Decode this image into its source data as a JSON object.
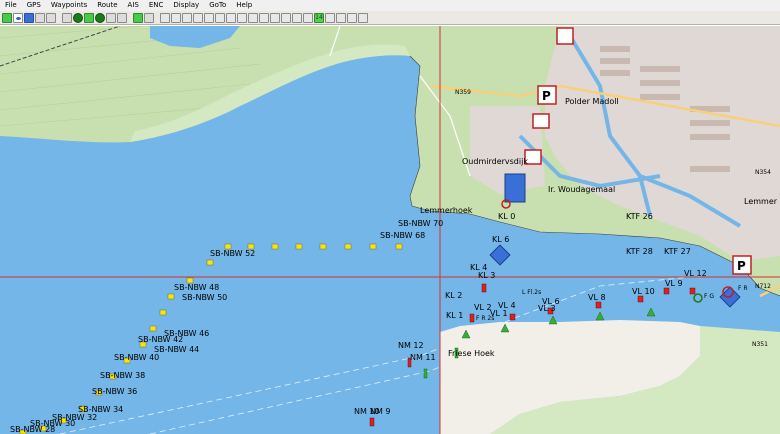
{
  "menu": [
    "File",
    "GPS",
    "Waypoints",
    "Route",
    "AIS",
    "ENC",
    "Display",
    "GoTo",
    "Help"
  ],
  "toolbar": {
    "zoom_levels": [
      "",
      "",
      "",
      "",
      "",
      "",
      "",
      "",
      "",
      "",
      "",
      "",
      "",
      "",
      "14",
      "",
      "",
      "",
      ""
    ],
    "active_zoom": "14"
  },
  "place_labels": {
    "polder": "Polder Madoll",
    "oudmirdum": "Oudmirdervsdijk",
    "woudagemaal": "Ir. Woudagemaal",
    "lemmer": "Lemmer",
    "friese_hoek": "Friese Hoek",
    "road_n359": "N359",
    "road_n712": "N712",
    "road_n354": "N354",
    "road_n351": "N351"
  },
  "chart_labels": [
    "SB-NBW 70",
    "SB-NBW 68",
    "SB-NBW 52",
    "SB-NBW 50",
    "SB-NBW 48",
    "SB-NBW 46",
    "SB-NBW 44",
    "SB-NBW 42",
    "SB-NBW 40",
    "SB-NBW 38",
    "SB-NBW 36",
    "SB-NBW 34",
    "SB-NBW 32",
    "SB-NBW 30",
    "SB-NBW 28",
    "KTF 26",
    "KTF 28",
    "KTF 27",
    "KL 4",
    "KL 3",
    "KL 2",
    "KL 1",
    "VL 2",
    "VL 1",
    "VL 4",
    "VL 3",
    "VL 6",
    "VL 8",
    "VL 10",
    "VL 9",
    "VL 12",
    "KL 6",
    "NM 12",
    "NM 11",
    "NM 10",
    "NM 9",
    "KL 0",
    "Lemmerhoek",
    "F G",
    "F R",
    "F R 2s",
    "L Fl.2s"
  ],
  "colors": {
    "water": "#74b6e8",
    "deep_water": "#5aa3dd",
    "land": "#f2efe9",
    "grass": "#d4e8c1",
    "farm": "#c8dfb0",
    "urban": "#e0d8d4",
    "cursor_line": "#d63030",
    "buoy_yellow": "#f3e21c",
    "buoy_red": "#dd2020",
    "buoy_green": "#35b035"
  }
}
